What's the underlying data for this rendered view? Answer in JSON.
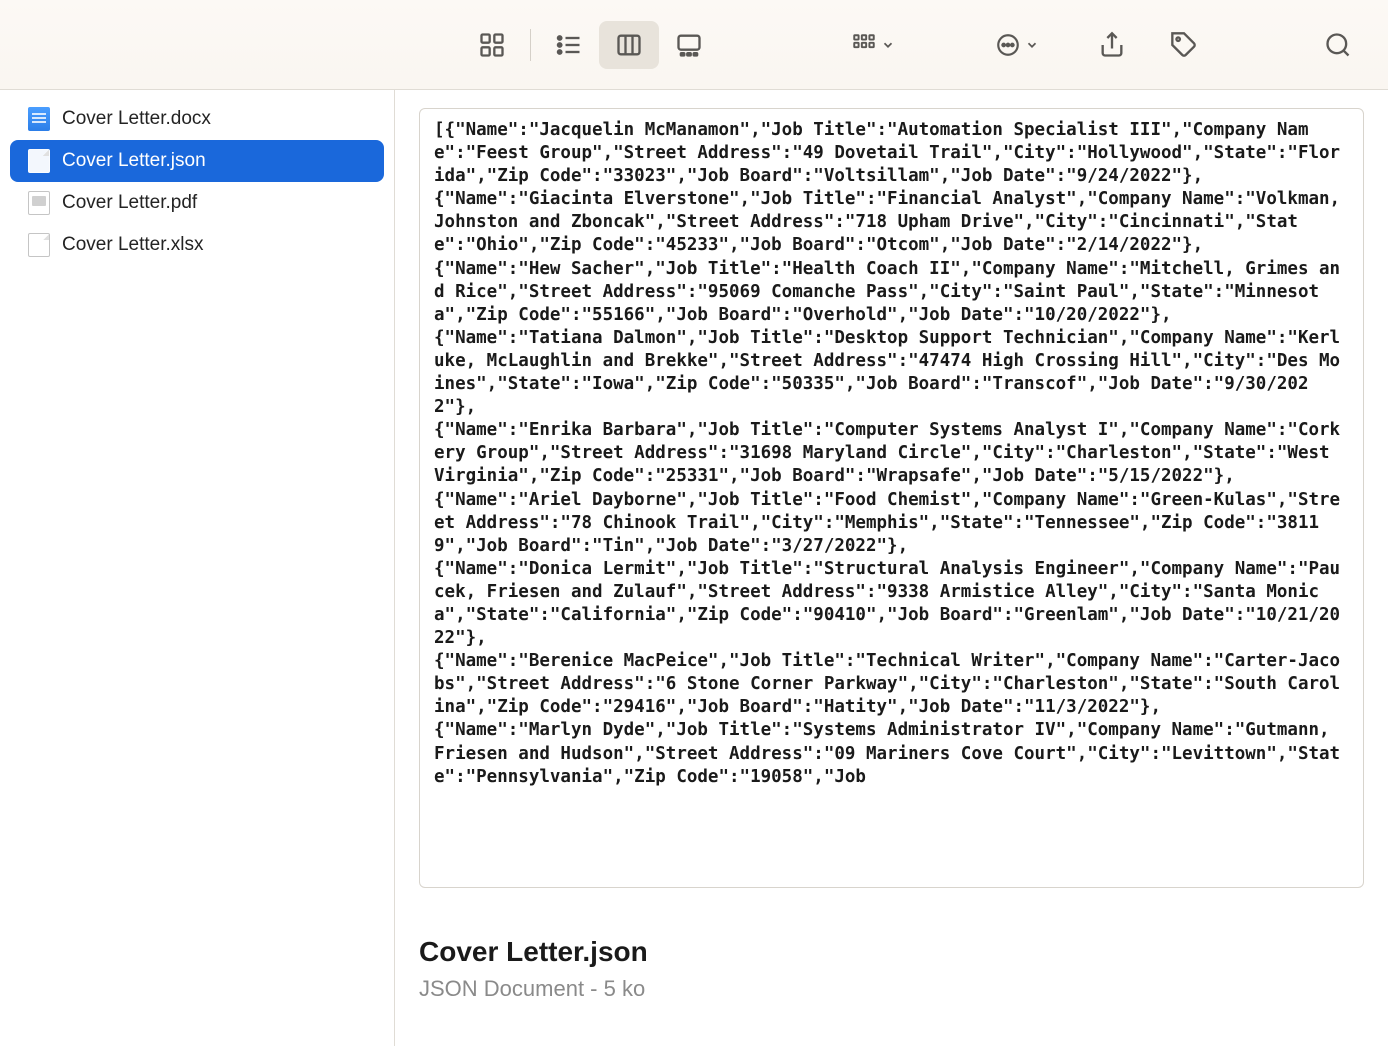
{
  "toolbar": {
    "view_icons": "icon-grid",
    "view_list": "list-icon",
    "view_columns": "columns-icon",
    "view_gallery": "gallery-icon",
    "group_by": "group-icon",
    "action": "action-icon",
    "share": "share-icon",
    "tags": "tags-icon",
    "search": "search-icon"
  },
  "sidebar": {
    "files": [
      {
        "name": "Cover Letter.docx",
        "type": "docx",
        "selected": false
      },
      {
        "name": "Cover Letter.json",
        "type": "generic",
        "selected": true
      },
      {
        "name": "Cover Letter.pdf",
        "type": "pdf",
        "selected": false
      },
      {
        "name": "Cover Letter.xlsx",
        "type": "generic",
        "selected": false
      }
    ]
  },
  "preview": {
    "content": "[{\"Name\":\"Jacquelin McManamon\",\"Job Title\":\"Automation Specialist III\",\"Company Name\":\"Feest Group\",\"Street Address\":\"49 Dovetail Trail\",\"City\":\"Hollywood\",\"State\":\"Florida\",\"Zip Code\":\"33023\",\"Job Board\":\"Voltsillam\",\"Job Date\":\"9/24/2022\"},\n{\"Name\":\"Giacinta Elverstone\",\"Job Title\":\"Financial Analyst\",\"Company Name\":\"Volkman, Johnston and Zboncak\",\"Street Address\":\"718 Upham Drive\",\"City\":\"Cincinnati\",\"State\":\"Ohio\",\"Zip Code\":\"45233\",\"Job Board\":\"Otcom\",\"Job Date\":\"2/14/2022\"},\n{\"Name\":\"Hew Sacher\",\"Job Title\":\"Health Coach II\",\"Company Name\":\"Mitchell, Grimes and Rice\",\"Street Address\":\"95069 Comanche Pass\",\"City\":\"Saint Paul\",\"State\":\"Minnesota\",\"Zip Code\":\"55166\",\"Job Board\":\"Overhold\",\"Job Date\":\"10/20/2022\"},\n{\"Name\":\"Tatiana Dalmon\",\"Job Title\":\"Desktop Support Technician\",\"Company Name\":\"Kerluke, McLaughlin and Brekke\",\"Street Address\":\"47474 High Crossing Hill\",\"City\":\"Des Moines\",\"State\":\"Iowa\",\"Zip Code\":\"50335\",\"Job Board\":\"Transcof\",\"Job Date\":\"9/30/2022\"},\n{\"Name\":\"Enrika Barbara\",\"Job Title\":\"Computer Systems Analyst I\",\"Company Name\":\"Corkery Group\",\"Street Address\":\"31698 Maryland Circle\",\"City\":\"Charleston\",\"State\":\"West Virginia\",\"Zip Code\":\"25331\",\"Job Board\":\"Wrapsafe\",\"Job Date\":\"5/15/2022\"},\n{\"Name\":\"Ariel Dayborne\",\"Job Title\":\"Food Chemist\",\"Company Name\":\"Green-Kulas\",\"Street Address\":\"78 Chinook Trail\",\"City\":\"Memphis\",\"State\":\"Tennessee\",\"Zip Code\":\"38119\",\"Job Board\":\"Tin\",\"Job Date\":\"3/27/2022\"},\n{\"Name\":\"Donica Lermit\",\"Job Title\":\"Structural Analysis Engineer\",\"Company Name\":\"Paucek, Friesen and Zulauf\",\"Street Address\":\"9338 Armistice Alley\",\"City\":\"Santa Monica\",\"State\":\"California\",\"Zip Code\":\"90410\",\"Job Board\":\"Greenlam\",\"Job Date\":\"10/21/2022\"},\n{\"Name\":\"Berenice MacPeice\",\"Job Title\":\"Technical Writer\",\"Company Name\":\"Carter-Jacobs\",\"Street Address\":\"6 Stone Corner Parkway\",\"City\":\"Charleston\",\"State\":\"South Carolina\",\"Zip Code\":\"29416\",\"Job Board\":\"Hatity\",\"Job Date\":\"11/3/2022\"},\n{\"Name\":\"Marlyn Dyde\",\"Job Title\":\"Systems Administrator IV\",\"Company Name\":\"Gutmann, Friesen and Hudson\",\"Street Address\":\"09 Mariners Cove Court\",\"City\":\"Levittown\",\"State\":\"Pennsylvania\",\"Zip Code\":\"19058\",\"Job",
    "filename": "Cover Letter.json",
    "meta": "JSON Document - 5 ko"
  }
}
